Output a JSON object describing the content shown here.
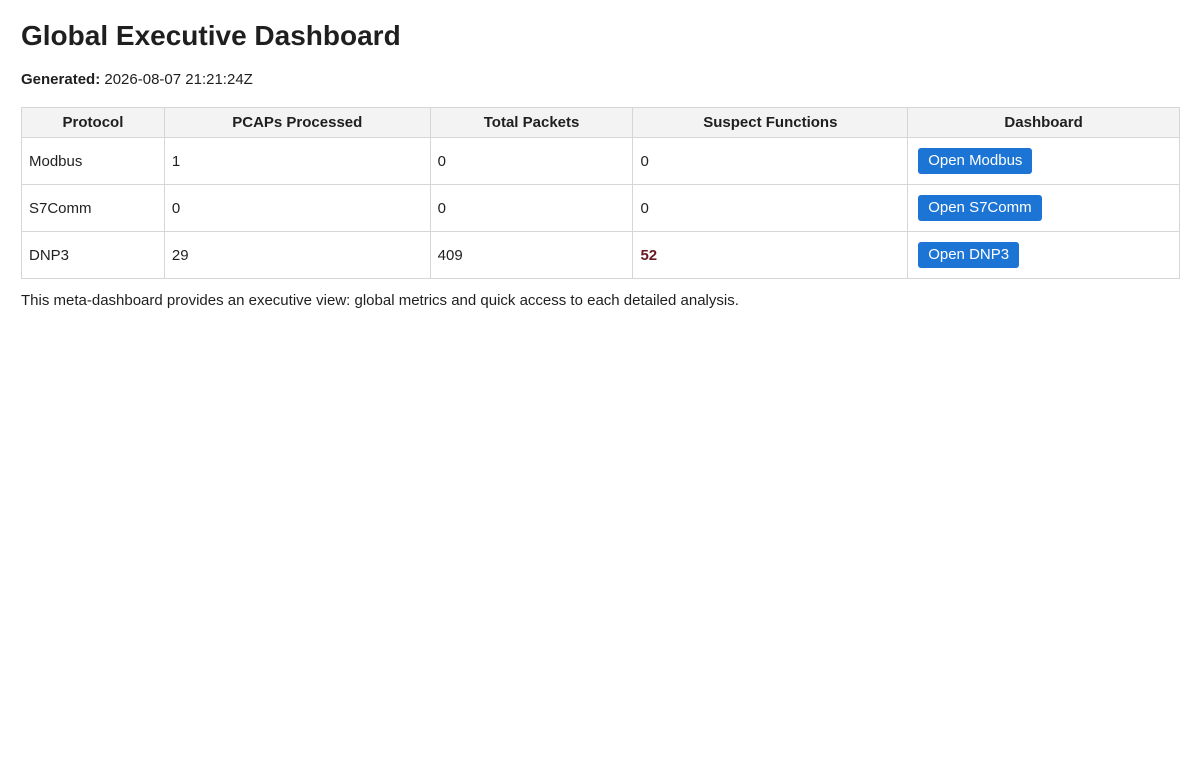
{
  "page": {
    "title": "Global Executive Dashboard",
    "generated_label": "Generated:",
    "generated_value": "2026-08-07 21:21:24Z",
    "footnote": "This meta-dashboard provides an executive view: global metrics and quick access to each detailed analysis."
  },
  "table": {
    "headers": [
      "Protocol",
      "PCAPs Processed",
      "Total Packets",
      "Suspect Functions",
      "Dashboard"
    ],
    "rows": [
      {
        "protocol": "Modbus",
        "pcaps": "1",
        "packets": "0",
        "suspect": "0",
        "button": "Open Modbus"
      },
      {
        "protocol": "S7Comm",
        "pcaps": "0",
        "packets": "0",
        "suspect": "0",
        "button": "Open S7Comm"
      },
      {
        "protocol": "DNP3",
        "pcaps": "29",
        "packets": "409",
        "suspect": "52",
        "button": "Open DNP3"
      }
    ]
  },
  "colors": {
    "button_bg": "#1c74d4",
    "suspect_highlight": "#6b1a24"
  }
}
